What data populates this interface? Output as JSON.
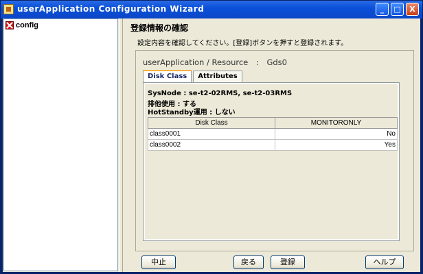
{
  "window": {
    "title": "userApplication Configuration Wizard",
    "buttons": {
      "minimize": "_",
      "maximize": "□",
      "close": "X"
    }
  },
  "tree": {
    "items": [
      {
        "label": "config",
        "icon": "error-icon"
      }
    ]
  },
  "main": {
    "heading": "登録情報の確認",
    "description": "設定内容を確認してください。[登録]ボタンを押すと登録されます。",
    "resource": {
      "label": "userApplication / Resource",
      "separator": ":",
      "value": "Gds0"
    },
    "tabs": [
      {
        "label": "Disk Class"
      },
      {
        "label": "Attributes"
      }
    ],
    "info": [
      "SysNode : se-t2-02RMS, se-t2-03RMS",
      "排他使用 : する",
      "HotStandby運用 : しない"
    ],
    "table": {
      "columns": [
        "Disk Class",
        "MONITORONLY"
      ],
      "rows": [
        [
          "class0001",
          "No"
        ],
        [
          "class0002",
          "Yes"
        ]
      ]
    }
  },
  "footer": {
    "cancel": "中止",
    "back": "戻る",
    "register": "登録",
    "help": "ヘルプ"
  }
}
